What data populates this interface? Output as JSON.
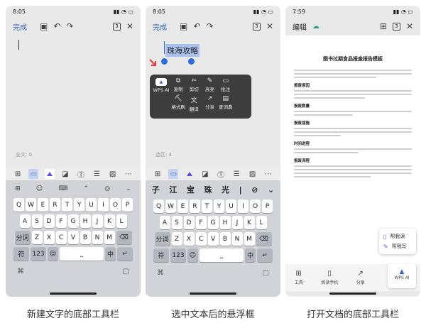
{
  "captions": [
    "新建文字的底部工具栏",
    "选中文本后的悬浮框",
    "打开文档的底部工具栏"
  ],
  "phone1": {
    "status_time": "8:05",
    "status_right": "4.0 Ᏸ ▮▮ ☰",
    "done_label": "完成",
    "page_count": "3",
    "word_count": "全文: 0",
    "keyboard_top": [
      "⊞",
      "☺",
      "⌨",
      "⌃",
      "◎",
      "⌄"
    ],
    "row1": [
      "Q",
      "W",
      "E",
      "R",
      "T",
      "Y",
      "U",
      "I",
      "O",
      "P"
    ],
    "row2": [
      "A",
      "S",
      "D",
      "F",
      "G",
      "H",
      "J",
      "K",
      "L"
    ],
    "row3": [
      "分词",
      "Z",
      "X",
      "C",
      "V",
      "B",
      "N",
      "M",
      "⌫"
    ],
    "row4": [
      "符",
      "123",
      "",
      "",
      "中",
      "↵"
    ]
  },
  "phone2": {
    "status_time": "8:05",
    "done_label": "完成",
    "page_count": "3",
    "selected_text": "珠海攻略",
    "word_count": "选区: 4",
    "wps_ai": "WPS AI",
    "menu": [
      "复制",
      "剪切",
      "高亮",
      "批注",
      "格式刷",
      "翻译",
      "分享",
      "查词典"
    ],
    "candidates": [
      "子",
      "江",
      "宝",
      "珠",
      "光",
      "|",
      "⊘",
      "⌄"
    ]
  },
  "phone3": {
    "status_time": "7:59",
    "edit_label": "编辑",
    "page_count": "3",
    "doc_title": "图书过期食品报废报告模板",
    "headings": [
      "报废原因",
      "报废数量",
      "报废措施",
      "时间进程",
      "报废流程"
    ],
    "float_menu": [
      "帮我读",
      "帮我写"
    ],
    "bottom": [
      "工具",
      "阅读手机",
      "分享"
    ],
    "wps_label": "WPS AI"
  }
}
